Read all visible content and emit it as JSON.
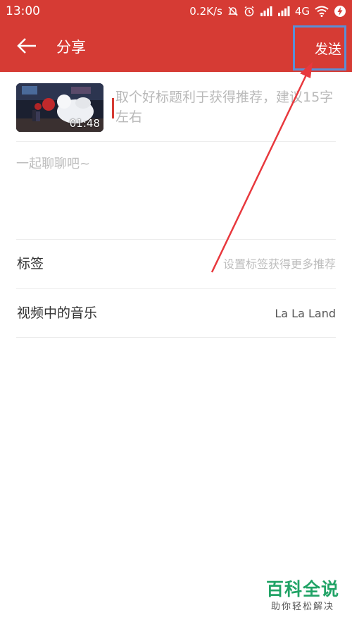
{
  "status_bar": {
    "time": "13:00",
    "network_speed": "0.2K/s",
    "network_type": "4G",
    "icons": [
      "mute-icon",
      "alarm-icon",
      "signal-icon",
      "signal-icon",
      "wifi-icon",
      "charging-icon"
    ]
  },
  "nav": {
    "back_icon": "back-arrow-icon",
    "title": "分享",
    "send_label": "发送"
  },
  "post": {
    "duration": "01:48",
    "title_placeholder": "取个好标题利于获得推荐，建议15字左右",
    "comment_placeholder": "一起聊聊吧~"
  },
  "options": {
    "tags": {
      "label": "标签",
      "value": "设置标签获得更多推荐"
    },
    "music": {
      "label": "视频中的音乐",
      "value": "La La Land"
    }
  },
  "watermark": {
    "title": "百科全说",
    "subtitle": "助你轻松解决"
  },
  "colors": {
    "brand_red": "#d63b34",
    "highlight_blue": "#5a8fd6",
    "placeholder_gray": "#b9b9b9",
    "watermark_green": "#21a366"
  }
}
